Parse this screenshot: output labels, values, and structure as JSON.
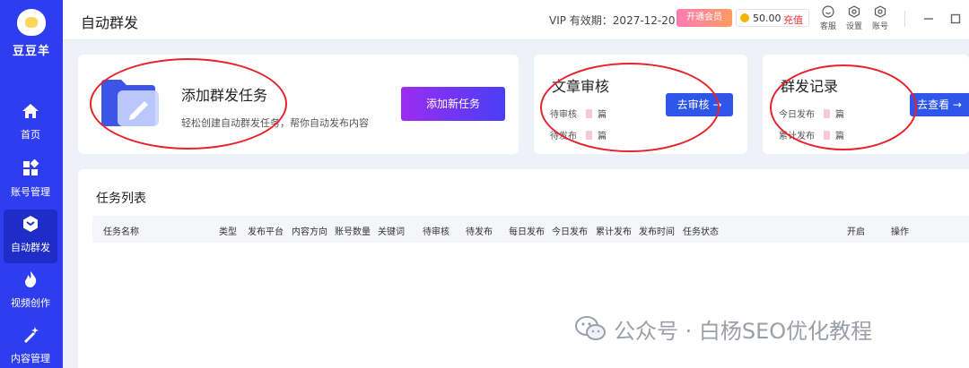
{
  "app": {
    "name": "豆豆羊",
    "page_title": "自动群发"
  },
  "sidebar": {
    "items": [
      {
        "label": "首页",
        "icon": "home-icon"
      },
      {
        "label": "账号管理",
        "icon": "grid-icon"
      },
      {
        "label": "自动群发",
        "icon": "send-cube-icon"
      },
      {
        "label": "视频创作",
        "icon": "flame-icon"
      },
      {
        "label": "内容管理",
        "icon": "magic-wand-icon"
      }
    ],
    "active": "自动群发"
  },
  "topbar": {
    "vip_text": "VIP 有效期：2027-12-20",
    "open_member_label": "开通会员",
    "balance": "50.00",
    "recharge_label": "充值",
    "tools": [
      {
        "label": "客服",
        "icon": "smile-icon"
      },
      {
        "label": "设置",
        "icon": "hex-gear-icon"
      },
      {
        "label": "账号",
        "icon": "hex-gear-icon"
      }
    ]
  },
  "add_task_card": {
    "title": "添加群发任务",
    "description": "轻松创建自动群发任务，帮你自动发布内容",
    "button_label": "添加新任务"
  },
  "review_card": {
    "title": "文章审核",
    "rows": [
      {
        "label": "待审核",
        "unit": "篇"
      },
      {
        "label": "待发布",
        "unit": "篇"
      }
    ],
    "button_label": "去审核 →"
  },
  "record_card": {
    "title": "群发记录",
    "rows": [
      {
        "label": "今日发布",
        "unit": "篇"
      },
      {
        "label": "累计发布",
        "unit": "篇"
      }
    ],
    "button_label": "去查看 →"
  },
  "task_list": {
    "title": "任务列表",
    "columns": [
      "任务名称",
      "类型",
      "发布平台",
      "内容方向",
      "账号数量",
      "关键词",
      "待审核",
      "待发布",
      "每日发布",
      "今日发布",
      "累计发布",
      "发布时间",
      "任务状态",
      "开启",
      "操作"
    ]
  },
  "watermark": "公众号 · 白杨SEO优化教程",
  "colors": {
    "sidebar": "#2e3df0",
    "primary": "#2e56e8",
    "accent_gradient_start": "#9b2cf0",
    "annotation": "#e8222a"
  }
}
